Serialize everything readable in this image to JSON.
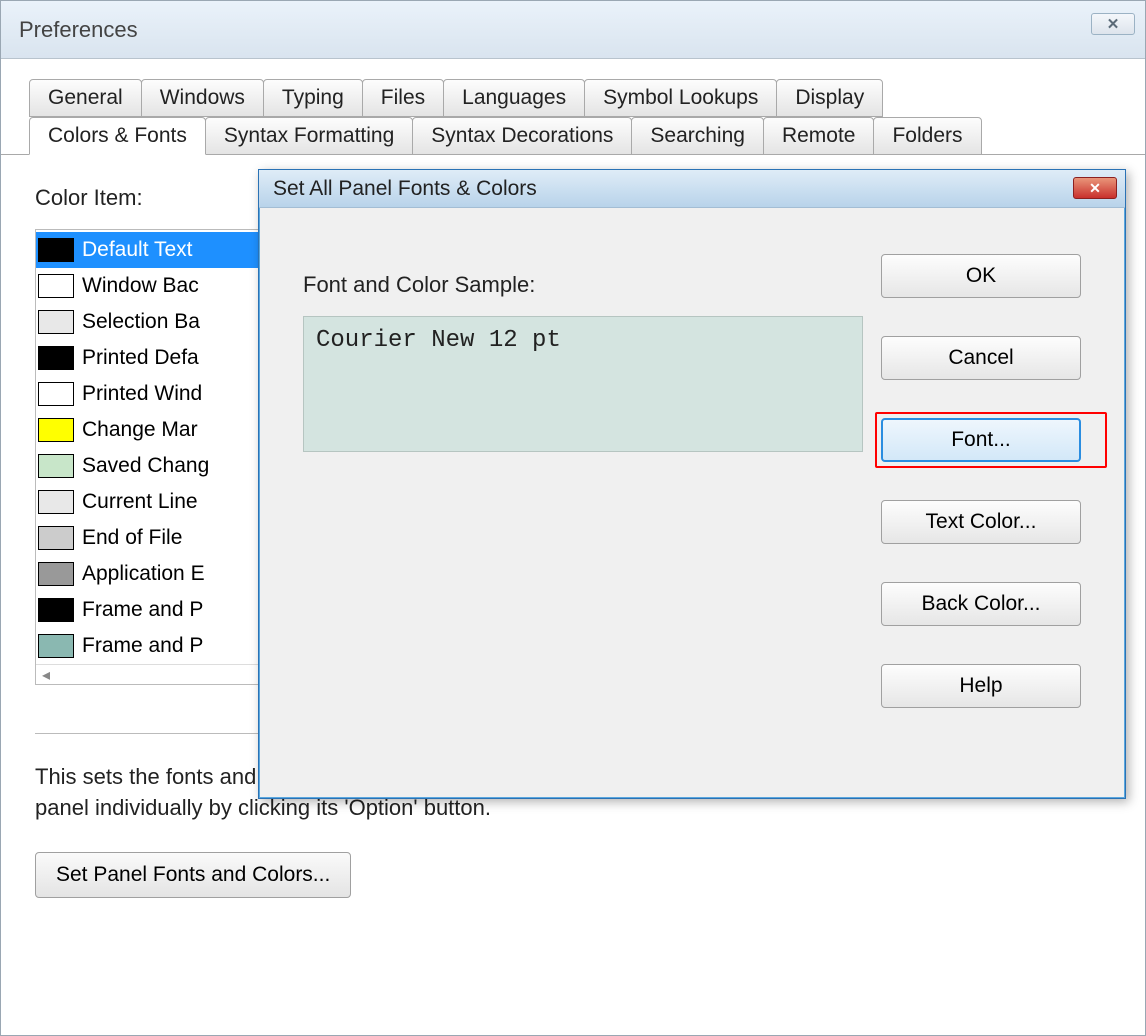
{
  "prefWindow": {
    "title": "Preferences",
    "close": "✕"
  },
  "tabsRow1": {
    "general": "General",
    "windows": "Windows",
    "typing": "Typing",
    "files": "Files",
    "languages": "Languages",
    "symbolLookups": "Symbol Lookups",
    "display": "Display"
  },
  "tabsRow2": {
    "colorsFonts": "Colors & Fonts",
    "syntaxFormatting": "Syntax Formatting",
    "syntaxDecorations": "Syntax Decorations",
    "searching": "Searching",
    "remote": "Remote",
    "folders": "Folders"
  },
  "colorItemLabel": "Color Item:",
  "colorItems": [
    {
      "color": "#000000",
      "label": "Default Text",
      "selected": true
    },
    {
      "color": "#ffffff",
      "label": "Window Bac"
    },
    {
      "color": "#e8e8e8",
      "label": "Selection Ba"
    },
    {
      "color": "#000000",
      "label": "Printed Defa"
    },
    {
      "color": "#ffffff",
      "label": "Printed Wind"
    },
    {
      "color": "#ffff00",
      "label": "Change Mar"
    },
    {
      "color": "#c8e6c9",
      "label": "Saved Chang"
    },
    {
      "color": "#e8e8e8",
      "label": "Current Line"
    },
    {
      "color": "#cccccc",
      "label": "End of File"
    },
    {
      "color": "#999999",
      "label": "Application E"
    },
    {
      "color": "#000000",
      "label": "Frame and P"
    },
    {
      "color": "#8ab8b1",
      "label": "Frame and P"
    }
  ],
  "description": "This sets the fonts and colors used in all panels. You can also change each panel individually by clicking its 'Option' button.",
  "setPanelBtn": "Set Panel Fonts and Colors...",
  "innerDialog": {
    "title": "Set All Panel Fonts & Colors",
    "close": "✕",
    "sampleLabel": "Font and Color Sample:",
    "sampleText": "Courier New 12 pt",
    "buttons": {
      "ok": "OK",
      "cancel": "Cancel",
      "font": "Font...",
      "textColor": "Text Color...",
      "backColor": "Back Color...",
      "help": "Help"
    }
  }
}
